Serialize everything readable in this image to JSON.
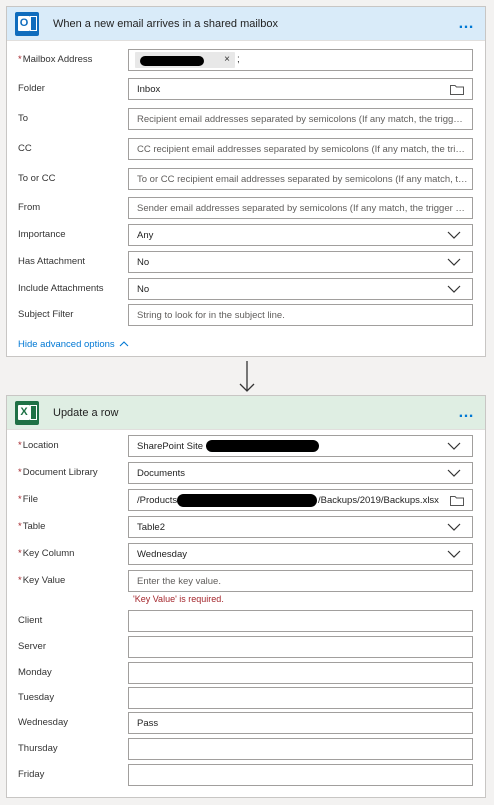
{
  "trigger": {
    "title": "When a new email arrives in a shared mailbox",
    "more_label": "…",
    "fields": {
      "mailbox": {
        "label": "Mailbox Address",
        "token_remove": "×",
        "separator": ";"
      },
      "folder": {
        "label": "Folder",
        "value": "Inbox"
      },
      "to": {
        "label": "To",
        "placeholder": "Recipient email addresses separated by semicolons (If any match, the trigger ..."
      },
      "cc": {
        "label": "CC",
        "placeholder": "CC recipient email addresses separated by semicolons (If any match, the trigg..."
      },
      "to_or_cc": {
        "label": "To or CC",
        "placeholder": "To or CC recipient email addresses separated by semicolons (If any match, th..."
      },
      "from": {
        "label": "From",
        "placeholder": "Sender email addresses separated by semicolons (If any match, the trigger wi..."
      },
      "importance": {
        "label": "Importance",
        "value": "Any"
      },
      "has_attachment": {
        "label": "Has Attachment",
        "value": "No"
      },
      "include_attachments": {
        "label": "Include Attachments",
        "value": "No"
      },
      "subject_filter": {
        "label": "Subject Filter",
        "placeholder": "String to look for in the subject line."
      }
    },
    "hide_advanced": "Hide advanced options"
  },
  "action": {
    "title": "Update a row",
    "more_label": "…",
    "fields": {
      "location": {
        "label": "Location",
        "value": "SharePoint Site -"
      },
      "document_library": {
        "label": "Document Library",
        "value": "Documents"
      },
      "file": {
        "label": "File",
        "value_start": "/Products",
        "value_end": "/Backups/2019/Backups.xlsx"
      },
      "table": {
        "label": "Table",
        "value": "Table2"
      },
      "key_column": {
        "label": "Key Column",
        "value": "Wednesday"
      },
      "key_value": {
        "label": "Key Value",
        "placeholder": "Enter the key value.",
        "error": "'Key Value' is required."
      },
      "client": {
        "label": "Client",
        "value": ""
      },
      "server": {
        "label": "Server",
        "value": ""
      },
      "monday": {
        "label": "Monday",
        "value": ""
      },
      "tuesday": {
        "label": "Tuesday",
        "value": ""
      },
      "wednesday": {
        "label": "Wednesday",
        "value": "Pass"
      },
      "thursday": {
        "label": "Thursday",
        "value": ""
      },
      "friday": {
        "label": "Friday",
        "value": ""
      }
    }
  },
  "required_mark": "*",
  "icons": {
    "outlook": "outlook-icon",
    "excel": "excel-icon",
    "chevron": "chevron-down-icon",
    "folder": "folder-icon",
    "arrow": "arrow-down-icon"
  },
  "colors": {
    "accent": "#0078d4",
    "trigger_header": "#d9ebf9",
    "action_header": "#dfeee3",
    "error": "#a4262c",
    "outlook": "#0f6cbd",
    "excel": "#1e7145"
  }
}
